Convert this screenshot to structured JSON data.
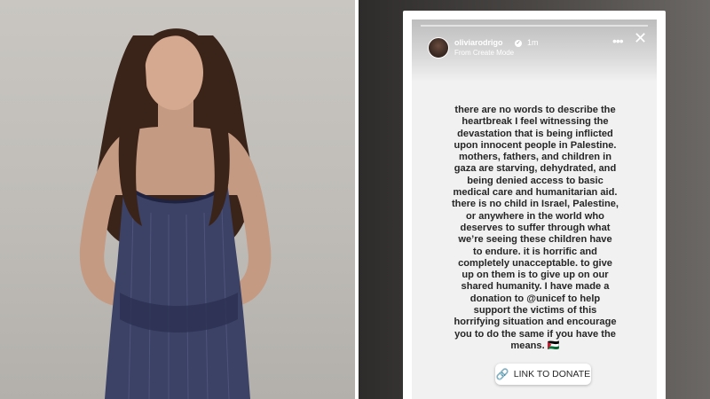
{
  "story": {
    "username": "oliviarodrigo",
    "verified_icon": "verified-badge-icon",
    "time": "1m",
    "sub_caption": "From Create Mode",
    "more_icon": "more-horizontal-icon",
    "close_icon": "close-icon",
    "lines": [
      "there are no words to describe the",
      "heartbreak I feel witnessing the",
      "devastation that is being inflicted",
      "upon innocent people in Palestine.",
      "mothers, fathers, and children in",
      "gaza are starving, dehydrated, and",
      "being denied access to basic",
      "medical care and humanitarian aid.",
      "there is no child in Israel, Palestine,",
      "or anywhere in the world who",
      "deserves to suffer through what",
      "we’re seeing these children have",
      "to endure. it is horrific and",
      "completely unacceptable. to give",
      "up on them is to give up on our",
      "shared humanity. I have made a",
      "donation to @unicef to help",
      "support the victims of this",
      "horrifying situation and encourage",
      "you to do the same if you have the",
      "means. 🇵🇸"
    ],
    "donate_label": "LINK TO DONATE",
    "link_icon": "link-icon"
  },
  "colors": {
    "accent_link": "#b5179e",
    "story_background": "#f1f1f1",
    "text": "#262626"
  }
}
